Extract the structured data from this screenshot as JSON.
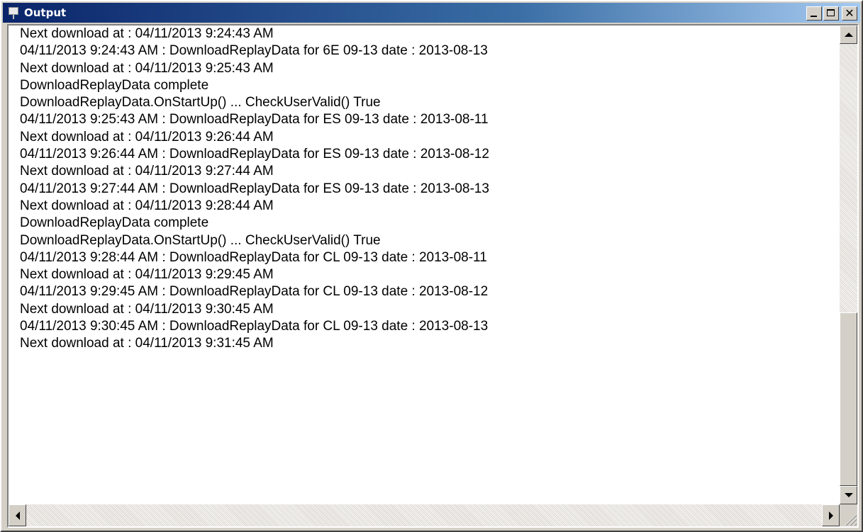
{
  "window": {
    "title": "Output",
    "icon": "board-icon"
  },
  "output": {
    "lines": [
      "Next download at : 04/11/2013 9:24:43 AM",
      "04/11/2013 9:24:43 AM : DownloadReplayData for 6E 09-13 date : 2013-08-13",
      "Next download at : 04/11/2013 9:25:43 AM",
      "DownloadReplayData complete",
      "DownloadReplayData.OnStartUp() ... CheckUserValid() True",
      "04/11/2013 9:25:43 AM : DownloadReplayData for ES 09-13 date : 2013-08-11",
      "Next download at : 04/11/2013 9:26:44 AM",
      "04/11/2013 9:26:44 AM : DownloadReplayData for ES 09-13 date : 2013-08-12",
      "Next download at : 04/11/2013 9:27:44 AM",
      "04/11/2013 9:27:44 AM : DownloadReplayData for ES 09-13 date : 2013-08-13",
      "Next download at : 04/11/2013 9:28:44 AM",
      "DownloadReplayData complete",
      "DownloadReplayData.OnStartUp() ... CheckUserValid() True",
      "04/11/2013 9:28:44 AM : DownloadReplayData for CL 09-13 date : 2013-08-11",
      "Next download at : 04/11/2013 9:29:45 AM",
      "04/11/2013 9:29:45 AM : DownloadReplayData for CL 09-13 date : 2013-08-12",
      "Next download at : 04/11/2013 9:30:45 AM",
      "04/11/2013 9:30:45 AM : DownloadReplayData for CL 09-13 date : 2013-08-13",
      "Next download at : 04/11/2013 9:31:45 AM"
    ]
  },
  "scrollbar": {
    "vertical_position": 0.63
  },
  "colors": {
    "titlebar_start": "#0a246a",
    "titlebar_end": "#a6caf0",
    "face": "#d4d0c8"
  }
}
